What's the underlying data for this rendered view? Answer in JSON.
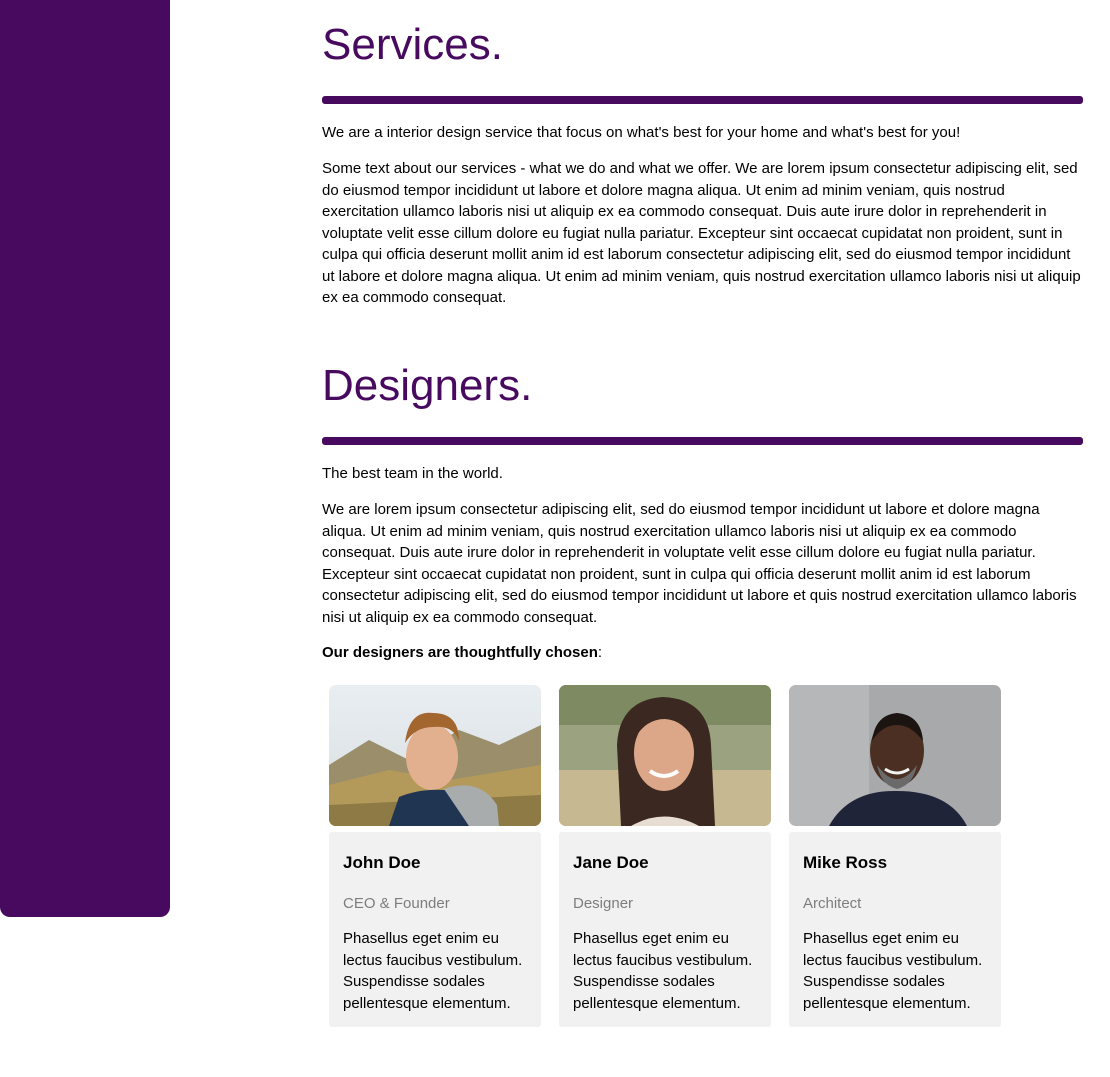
{
  "services": {
    "title": "Services.",
    "lead": "We are a interior design service that focus on what's best for your home and what's best for you!",
    "body": "Some text about our services - what we do and what we offer. We are lorem ipsum consectetur adipiscing elit, sed do eiusmod tempor incididunt ut labore et dolore magna aliqua. Ut enim ad minim veniam, quis nostrud exercitation ullamco laboris nisi ut aliquip ex ea commodo consequat. Duis aute irure dolor in reprehenderit in voluptate velit esse cillum dolore eu fugiat nulla pariatur. Excepteur sint occaecat cupidatat non proident, sunt in culpa qui officia deserunt mollit anim id est laborum consectetur adipiscing elit, sed do eiusmod tempor incididunt ut labore et dolore magna aliqua. Ut enim ad minim veniam, quis nostrud exercitation ullamco laboris nisi ut aliquip ex ea commodo consequat."
  },
  "designers": {
    "title": "Designers.",
    "lead": "The best team in the world.",
    "body": "We are lorem ipsum consectetur adipiscing elit, sed do eiusmod tempor incididunt ut labore et dolore magna aliqua. Ut enim ad minim veniam, quis nostrud exercitation ullamco laboris nisi ut aliquip ex ea commodo consequat. Duis aute irure dolor in reprehenderit in voluptate velit esse cillum dolore eu fugiat nulla pariatur. Excepteur sint occaecat cupidatat non proident, sunt in culpa qui officia deserunt mollit anim id est laborum consectetur adipiscing elit, sed do eiusmod tempor incididunt ut labore et quis nostrud exercitation ullamco laboris nisi ut aliquip ex ea commodo consequat.",
    "chosen_bold": "Our designers are thoughtfully chosen",
    "chosen_suffix": ":",
    "team": [
      {
        "name": "John Doe",
        "role": "CEO & Founder",
        "description": "Phasellus eget enim eu lectus faucibus vestibulum. Suspendisse sodales pellentesque elementum."
      },
      {
        "name": "Jane Doe",
        "role": "Designer",
        "description": "Phasellus eget enim eu lectus faucibus vestibulum. Suspendisse sodales pellentesque elementum."
      },
      {
        "name": "Mike Ross",
        "role": "Architect",
        "description": "Phasellus eget enim eu lectus faucibus vestibulum. Suspendisse sodales pellentesque elementum."
      }
    ]
  },
  "colors": {
    "brand": "#470a5f",
    "card_background": "#f1f1f1",
    "muted_text": "#7d7d7d"
  }
}
